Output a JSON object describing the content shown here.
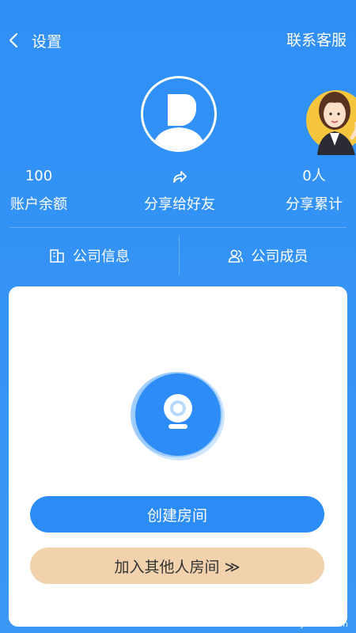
{
  "topbar": {
    "back_label": "设置",
    "service_label": "联系客服"
  },
  "stats": {
    "balance_value": "100",
    "balance_label": "账户余额",
    "share_label": "分享给好友",
    "share_count_value": "0人",
    "share_count_label": "分享累计"
  },
  "tabs": {
    "company_info": "公司信息",
    "company_members": "公司成员"
  },
  "card": {
    "create_button": "创建房间",
    "join_button": "加入其他人房间 ≫"
  },
  "watermark": {
    "brand": "007游戏网",
    "url": "www.yx007.com"
  },
  "colors": {
    "background": "#2f8ff6",
    "primary_button": "#2c8cf5",
    "secondary_button": "#f1d2ad"
  },
  "icons": [
    "back-chevron-icon",
    "default-avatar-icon",
    "customer-service-lady-icon",
    "share-arrow-icon",
    "building-icon",
    "users-icon",
    "camera-icon"
  ]
}
